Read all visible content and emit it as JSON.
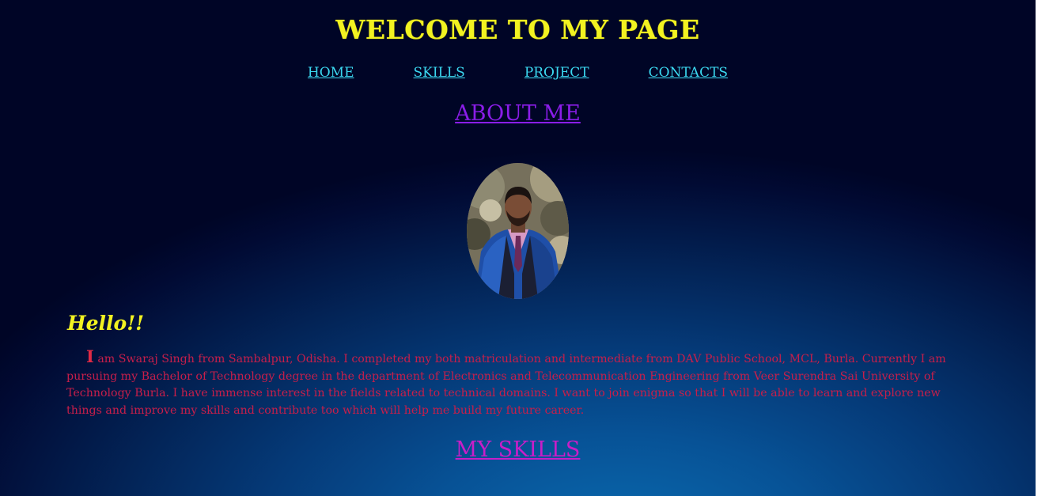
{
  "header": {
    "title": "WELCOME TO MY PAGE"
  },
  "nav": {
    "items": [
      {
        "label": "HOME"
      },
      {
        "label": "SKILLS"
      },
      {
        "label": "PROJECT"
      },
      {
        "label": "CONTACTS"
      }
    ]
  },
  "about": {
    "heading": "ABOUT ME",
    "greeting": "Hello!!",
    "bio_first_letter": "I",
    "bio_rest": " am Swaraj Singh from Sambalpur, Odisha. I completed my both matriculation and intermediate from DAV Public School, MCL, Burla. Currently I am pursuing my Bachelor of Technology degree in the department of Electronics and Telecommunication Engineering from Veer Surendra Sai University of Technology Burla. I have immense interest in the fields related to technical domains. I want to join enigma so that I will be able to learn and explore new things and improve my skills and contribute too which will help me build my future career."
  },
  "skills": {
    "heading": "MY SKILLS"
  },
  "colors": {
    "title": "#f2f221",
    "nav_link": "#3bd8f0",
    "about_heading": "#8a1de8",
    "bio_text": "#c81e4a",
    "skills_heading": "#c81ec8",
    "background_dark": "#000526",
    "background_light": "#0a6bb0"
  }
}
